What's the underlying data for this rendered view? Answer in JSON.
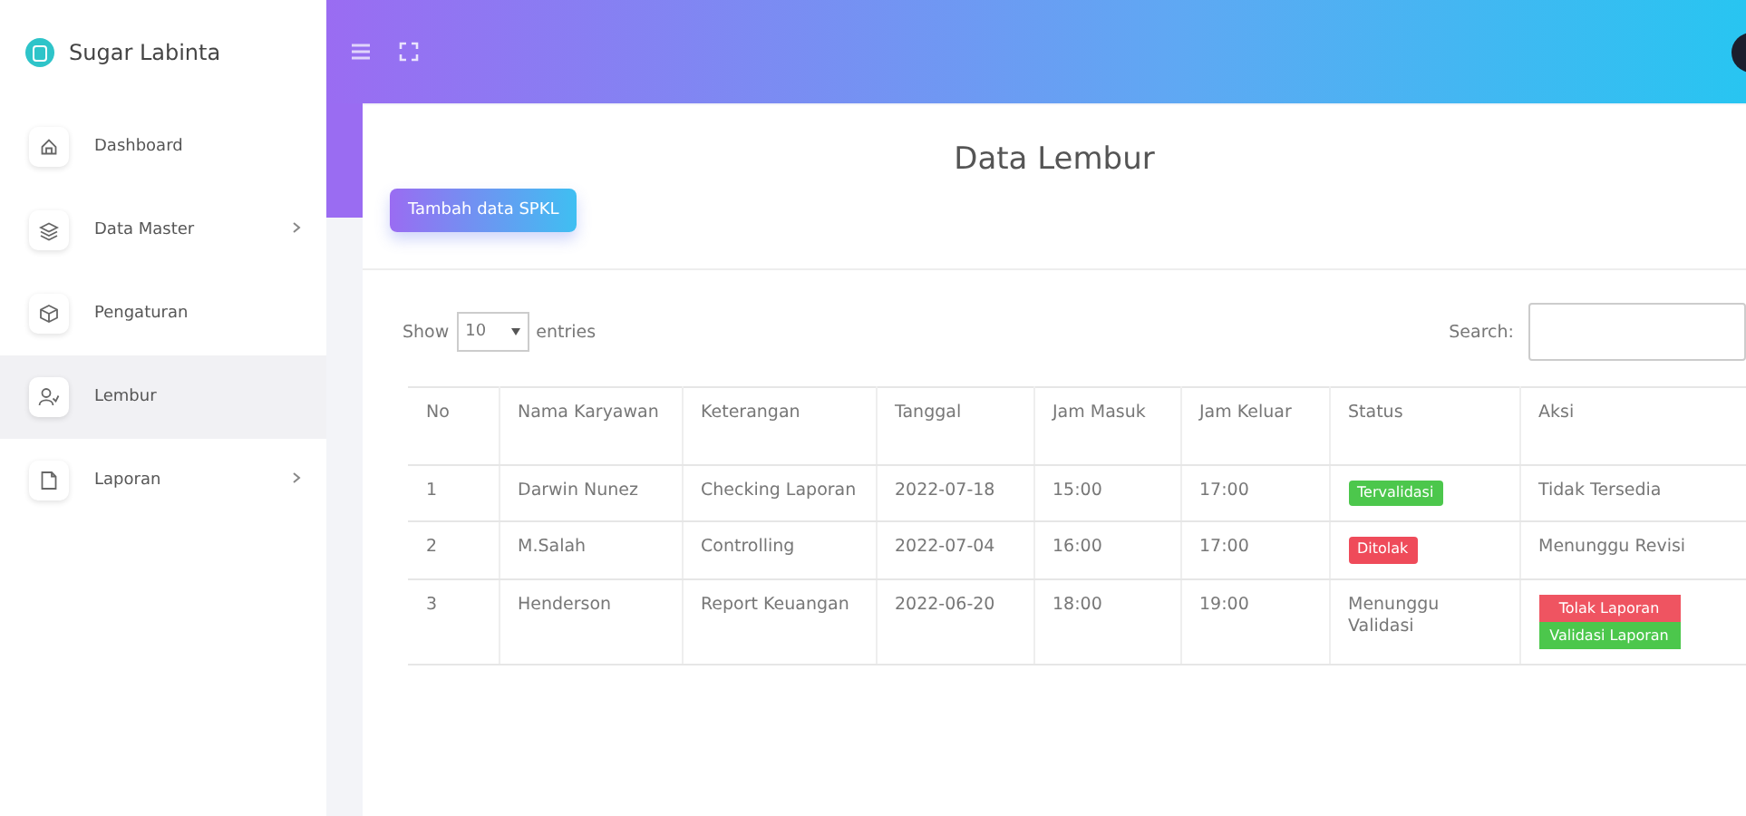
{
  "sidebar": {
    "brand": "Sugar Labinta",
    "items": [
      {
        "label": "Dashboard",
        "has_submenu": false,
        "selected": false
      },
      {
        "label": "Data Master",
        "has_submenu": true,
        "selected": false
      },
      {
        "label": "Pengaturan",
        "has_submenu": false,
        "selected": false
      },
      {
        "label": "Lembur",
        "has_submenu": false,
        "selected": true
      },
      {
        "label": "Laporan",
        "has_submenu": true,
        "selected": false
      }
    ]
  },
  "page": {
    "title": "Data Lembur",
    "add_button": "Tambah data SPKL"
  },
  "table_controls": {
    "show_label": "Show",
    "page_size": "10",
    "entries_label": "entries",
    "search_label": "Search:"
  },
  "table": {
    "columns": [
      "No",
      "Nama Karyawan",
      "Keterangan",
      "Tanggal",
      "Jam Masuk",
      "Jam Keluar",
      "Status",
      "Aksi"
    ],
    "rows": [
      {
        "no": "1",
        "name": "Darwin Nunez",
        "note": "Checking Laporan",
        "date": "2022-07-18",
        "in": "15:00",
        "out": "17:00",
        "status": {
          "kind": "badge",
          "text": "Tervalidasi",
          "color": "#4cc74c"
        },
        "action": {
          "kind": "text",
          "text": "Tidak Tersedia"
        }
      },
      {
        "no": "2",
        "name": "M.Salah",
        "note": "Controlling",
        "date": "2022-07-04",
        "in": "16:00",
        "out": "17:00",
        "status": {
          "kind": "badge",
          "text": "Ditolak",
          "color": "#ef4b5a"
        },
        "action": {
          "kind": "text",
          "text": "Menunggu Revisi"
        }
      },
      {
        "no": "3",
        "name": "Henderson",
        "note": "Report Keuangan",
        "date": "2022-06-20",
        "in": "18:00",
        "out": "19:00",
        "status": {
          "kind": "text",
          "text": "Menunggu Validasi"
        },
        "action": {
          "kind": "buttons",
          "buttons": [
            "Tolak Laporan",
            "Validasi Laporan"
          ]
        }
      }
    ]
  }
}
